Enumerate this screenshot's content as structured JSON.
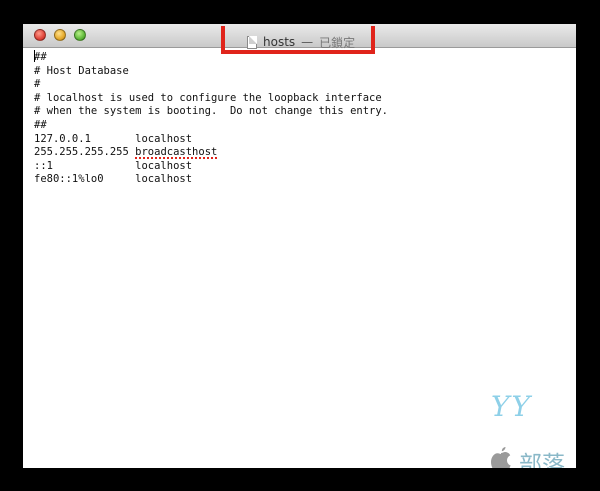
{
  "window": {
    "title": "hosts",
    "title_separator": "—",
    "title_status": "已鎖定"
  },
  "editor": {
    "lines": [
      "##",
      "# Host Database",
      "#",
      "# localhost is used to configure the loopback interface",
      "# when the system is booting.  Do not change this entry.",
      "##",
      "127.0.0.1       localhost",
      "255.255.255.255 ",
      "::1             localhost",
      "fe80::1%lo0     localhost"
    ],
    "misspelled_word": "broadcasthost"
  },
  "watermark": {
    "logo_text": "YY",
    "text": "部落"
  },
  "colors": {
    "highlight": "#e0241b",
    "watermark": "#8ed0e8"
  }
}
